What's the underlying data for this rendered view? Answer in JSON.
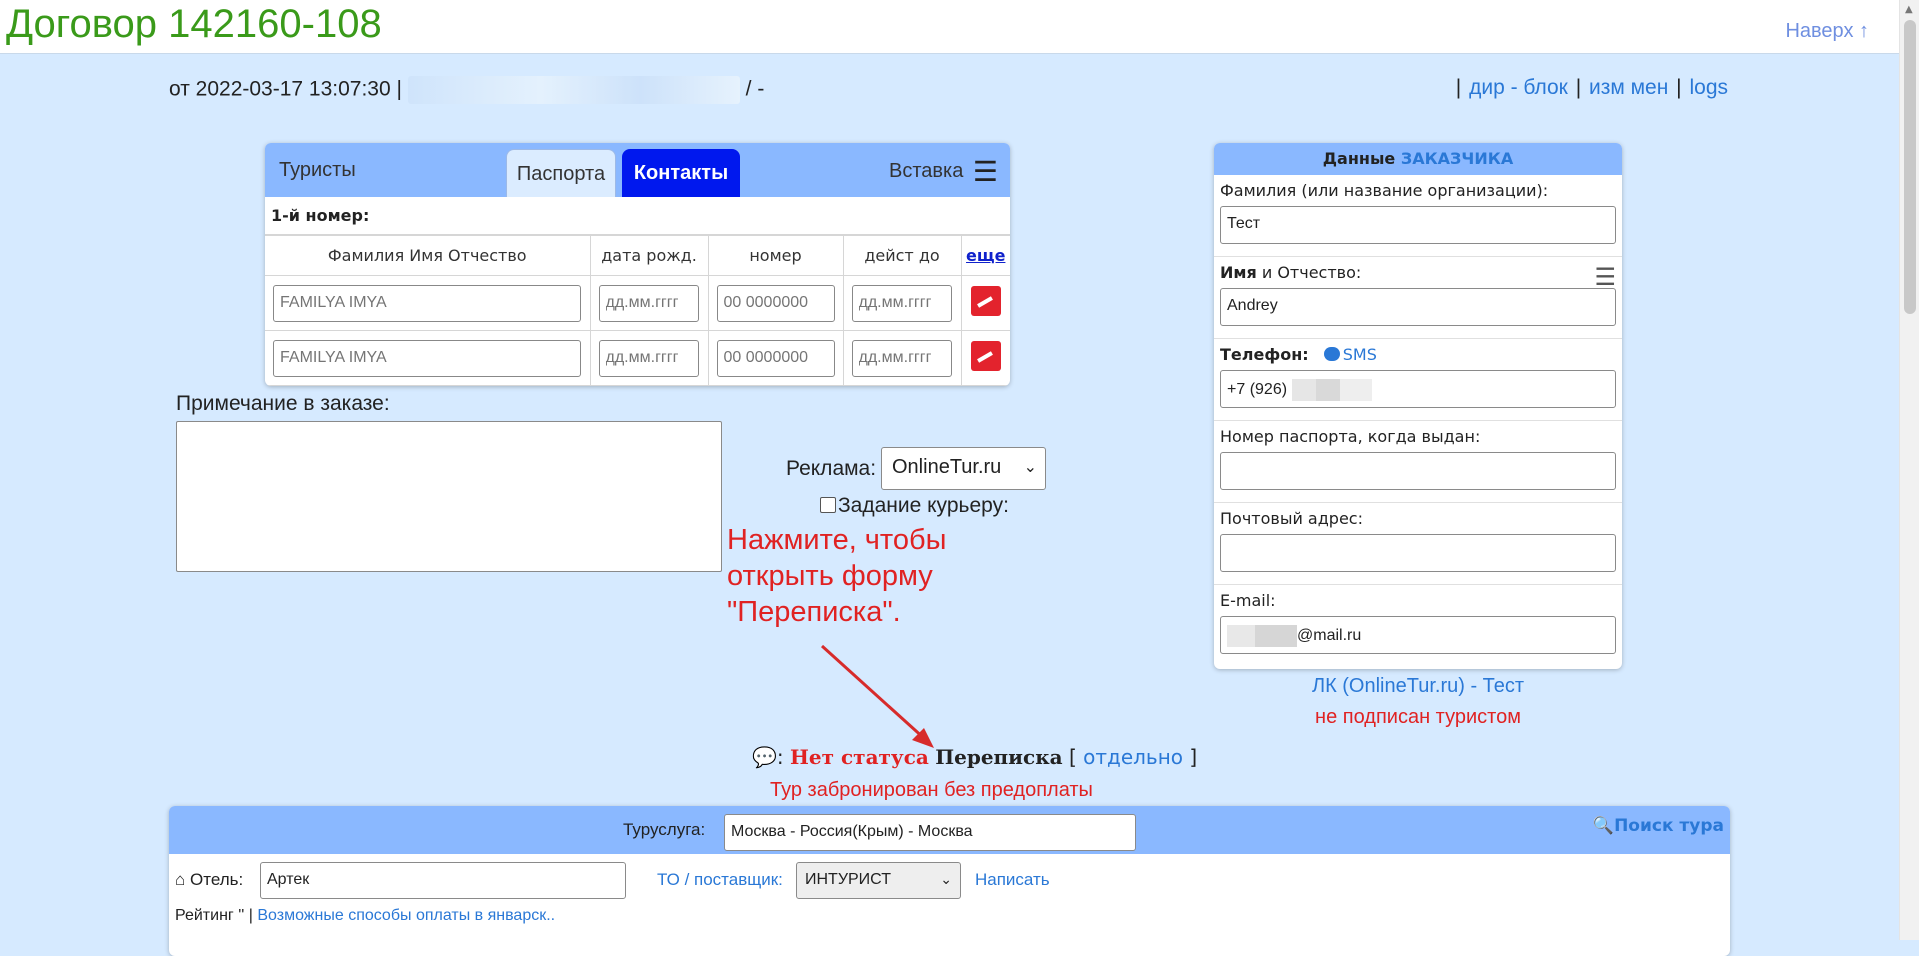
{
  "header": {
    "title": "Договор 142160-108",
    "back_to_top": "Наверх ↑"
  },
  "meta": {
    "prefix": "от 2022-03-17 13:07:30 |",
    "suffix": "/ -"
  },
  "top_links": [
    "дир - блок",
    "изм мен",
    "logs"
  ],
  "tourists": {
    "title": "Туристы",
    "tabs": [
      "Паспорта",
      "Контакты"
    ],
    "insert_label": "Вставка",
    "sub": "1-й номер:",
    "columns": [
      "Фамилия Имя Отчество",
      "дата рожд.",
      "номер",
      "дейст до",
      "еще"
    ],
    "rows": [
      {
        "name_ph": "FAMILYA IMYA",
        "dob_ph": "дд.мм.гггг",
        "num_ph": "00 0000000",
        "exp_ph": "дд.мм.гггг"
      },
      {
        "name_ph": "FAMILYA IMYA",
        "dob_ph": "дд.мм.гггг",
        "num_ph": "00 0000000",
        "exp_ph": "дд.мм.гггг"
      }
    ]
  },
  "note": {
    "label": "Примечание в заказе:"
  },
  "ads": {
    "label": "Реклама:",
    "value": "OnlineTur.ru",
    "courier": "Задание курьеру:"
  },
  "hint": "Нажмите, чтобы открыть форму \"Переписка\".",
  "correspondence": {
    "status": "Нет статуса",
    "title": "Переписка",
    "open_left": "[",
    "separate": "отдельно",
    "open_right": "]"
  },
  "booked": "Тур забронирован без предоплаты",
  "customer": {
    "head_prefix": "Данные",
    "head_accent": "ЗАКАЗЧИКА",
    "surname_label": "Фамилия (или название организации):",
    "surname_value": "Тест",
    "name_label_bold": "Имя",
    "name_label_rest": "и Отчество:",
    "name_value": "Andrey",
    "phone_label": "Телефон:",
    "sms": "SMS",
    "phone_value": "+7 (926)",
    "passport_label": "Номер паспорта, когда выдан:",
    "address_label": "Почтовый адрес:",
    "email_label": "E-mail:",
    "email_value": "@mail.ru"
  },
  "lk": {
    "line1": "ЛК (OnlineTur.ru) - Тест",
    "line2": "не подписан туристом"
  },
  "service": {
    "label": "Туруслуга:",
    "value": "Москва - Россия(Крым) - Москва",
    "search": "Поиск тура",
    "hotel_label": "Отель:",
    "hotel_value": "Артек",
    "to_label": "ТО / поставщик:",
    "to_value": "ИНТУРИСТ",
    "write": "Написать",
    "rating": "Рейтинг '' |",
    "payment_link": "Возможные способы оплаты в январск.."
  }
}
